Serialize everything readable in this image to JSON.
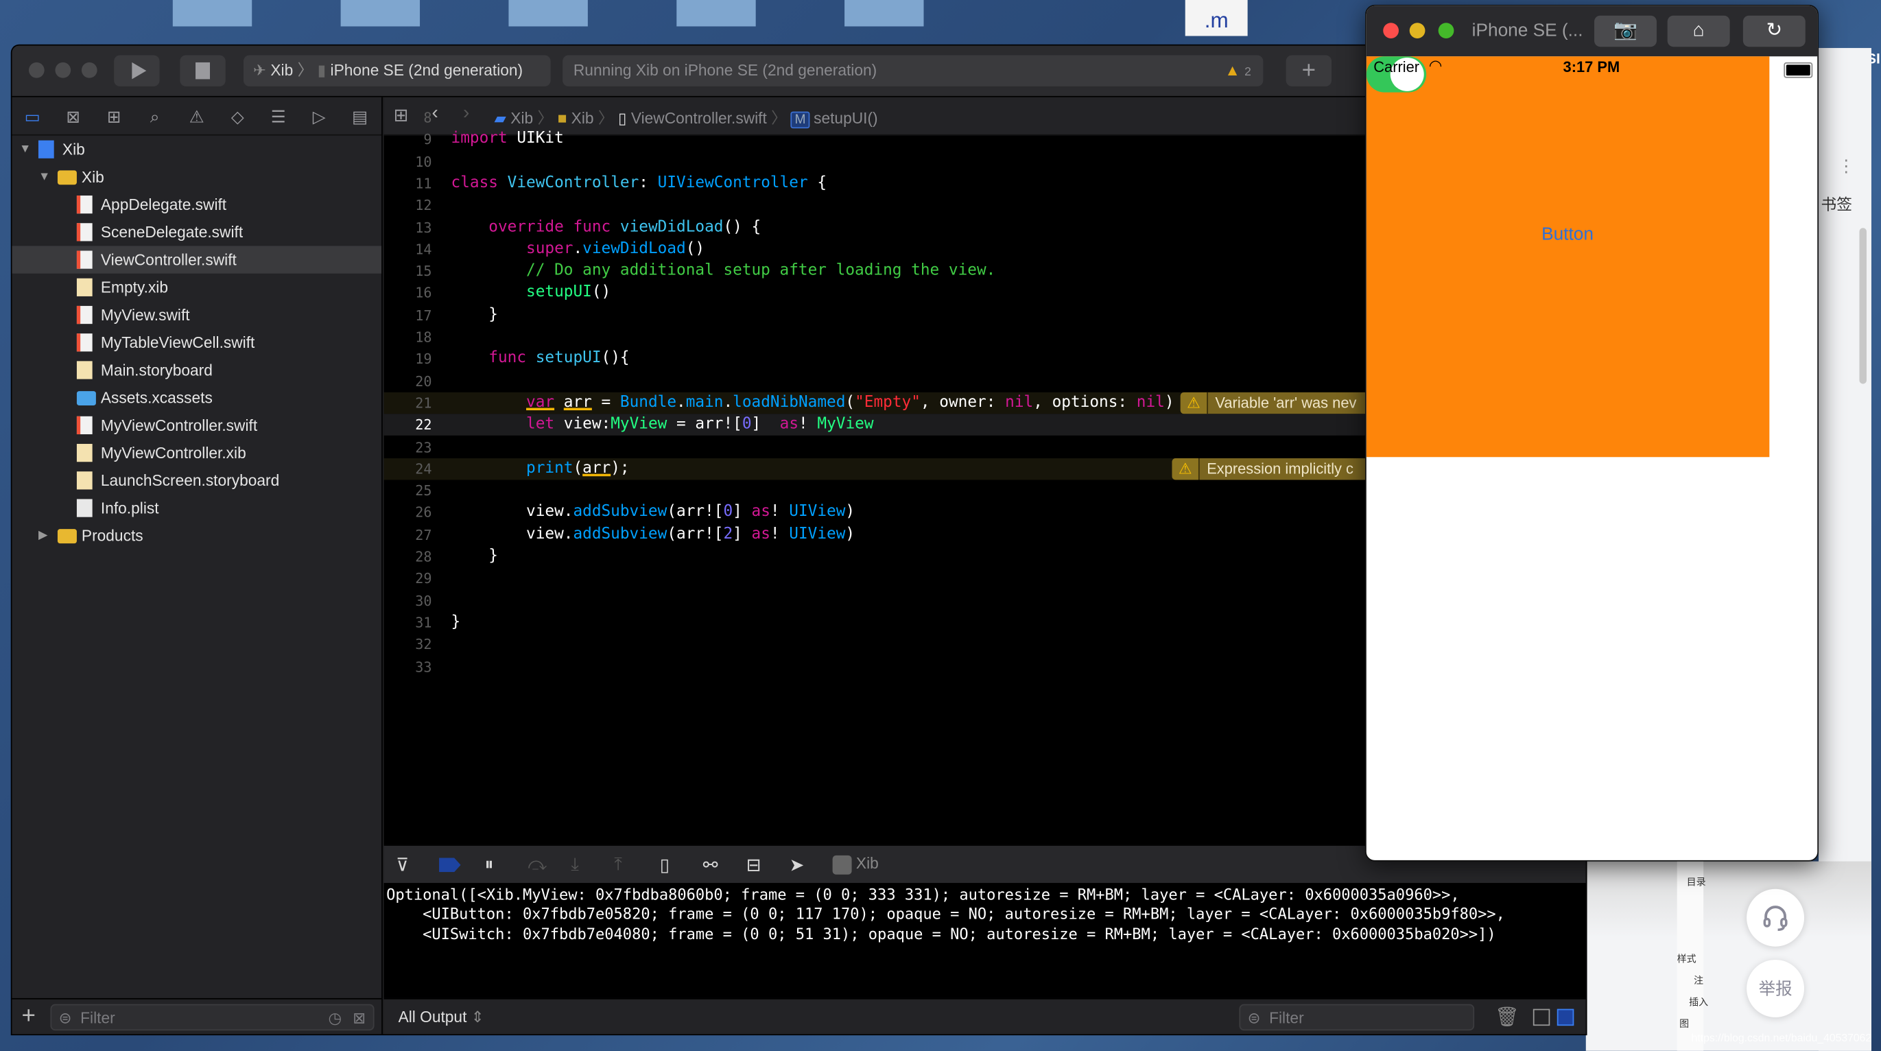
{
  "desktop": {
    "thumbnail_label": ".m",
    "right_edge_text": "SI"
  },
  "xcode": {
    "toolbar": {
      "scheme": "Xib",
      "device": "iPhone SE (2nd generation)",
      "status": "Running Xib on iPhone SE (2nd generation)",
      "warning_count": "2",
      "add_label": "+"
    },
    "jumpbar": [
      "Xib",
      "Xib",
      "ViewController.swift",
      "setupUI()"
    ],
    "jumpbar_method_badge": "M",
    "navigator": {
      "items": [
        {
          "label": "Xib",
          "icon": "xcode-project-icon",
          "level": 0,
          "disclosure": "open"
        },
        {
          "label": "Xib",
          "icon": "folder-icon",
          "level": 1,
          "disclosure": "open"
        },
        {
          "label": "AppDelegate.swift",
          "icon": "swift-file-icon",
          "level": 2
        },
        {
          "label": "SceneDelegate.swift",
          "icon": "swift-file-icon",
          "level": 2
        },
        {
          "label": "ViewController.swift",
          "icon": "swift-file-icon",
          "level": 2,
          "selected": true
        },
        {
          "label": "Empty.xib",
          "icon": "xib-file-icon",
          "level": 2
        },
        {
          "label": "MyView.swift",
          "icon": "swift-file-icon",
          "level": 2
        },
        {
          "label": "MyTableViewCell.swift",
          "icon": "swift-file-icon",
          "level": 2
        },
        {
          "label": "Main.storyboard",
          "icon": "storyboard-file-icon",
          "level": 2
        },
        {
          "label": "Assets.xcassets",
          "icon": "asset-folder-icon",
          "level": 2
        },
        {
          "label": "MyViewController.swift",
          "icon": "swift-file-icon",
          "level": 2
        },
        {
          "label": "MyViewController.xib",
          "icon": "xib-file-icon",
          "level": 2
        },
        {
          "label": "LaunchScreen.storyboard",
          "icon": "storyboard-file-icon",
          "level": 2
        },
        {
          "label": "Info.plist",
          "icon": "plist-file-icon",
          "level": 2
        },
        {
          "label": "Products",
          "icon": "folder-icon",
          "level": 1,
          "disclosure": "closed"
        }
      ],
      "filter_placeholder": "Filter"
    },
    "editor": {
      "current_line": 22,
      "lines": [
        {
          "n": "8",
          "t": []
        },
        {
          "n": "9",
          "t": [
            [
              "k",
              "import"
            ],
            [
              "p",
              " UIKit"
            ]
          ]
        },
        {
          "n": "10",
          "t": []
        },
        {
          "n": "11",
          "t": [
            [
              "k",
              "class"
            ],
            [
              "p",
              " "
            ],
            [
              "d",
              "ViewController"
            ],
            [
              "p",
              ": "
            ],
            [
              "o",
              "UIViewController"
            ],
            [
              "p",
              " {"
            ]
          ]
        },
        {
          "n": "12",
          "t": []
        },
        {
          "n": "13",
          "t": [
            [
              "p",
              "    "
            ],
            [
              "k",
              "override"
            ],
            [
              "p",
              " "
            ],
            [
              "k",
              "func"
            ],
            [
              "p",
              " "
            ],
            [
              "d",
              "viewDidLoad"
            ],
            [
              "p",
              "() {"
            ]
          ]
        },
        {
          "n": "14",
          "t": [
            [
              "p",
              "        "
            ],
            [
              "k",
              "super"
            ],
            [
              "p",
              "."
            ],
            [
              "o",
              "viewDidLoad"
            ],
            [
              "p",
              "()"
            ]
          ]
        },
        {
          "n": "15",
          "t": [
            [
              "p",
              "        "
            ],
            [
              "c",
              "// Do any additional setup after loading the view."
            ]
          ]
        },
        {
          "n": "16",
          "t": [
            [
              "p",
              "        "
            ],
            [
              "g",
              "setupUI"
            ],
            [
              "p",
              "()"
            ]
          ]
        },
        {
          "n": "17",
          "t": [
            [
              "p",
              "    }"
            ]
          ]
        },
        {
          "n": "18",
          "t": []
        },
        {
          "n": "19",
          "t": [
            [
              "p",
              "    "
            ],
            [
              "k",
              "func"
            ],
            [
              "p",
              " "
            ],
            [
              "d",
              "setupUI"
            ],
            [
              "p",
              "(){"
            ]
          ]
        },
        {
          "n": "20",
          "t": []
        },
        {
          "n": "21",
          "t": [
            [
              "p",
              "        "
            ],
            [
              "ku",
              "var"
            ],
            [
              "p",
              " "
            ],
            [
              "pu",
              "arr"
            ],
            [
              "p",
              " = "
            ],
            [
              "o",
              "Bundle"
            ],
            [
              "p",
              "."
            ],
            [
              "o",
              "main"
            ],
            [
              "p",
              "."
            ],
            [
              "o",
              "loadNibNamed"
            ],
            [
              "p",
              "("
            ],
            [
              "s",
              "\"Empty\""
            ],
            [
              "p",
              ", owner: "
            ],
            [
              "k",
              "nil"
            ],
            [
              "p",
              ", options: "
            ],
            [
              "k",
              "nil"
            ],
            [
              "p",
              ")"
            ]
          ],
          "warning": "Variable 'arr' was nev"
        },
        {
          "n": "22",
          "t": [
            [
              "p",
              "        "
            ],
            [
              "k",
              "let"
            ],
            [
              "p",
              " view:"
            ],
            [
              "g",
              "MyView"
            ],
            [
              "p",
              " = arr!["
            ],
            [
              "n",
              "0"
            ],
            [
              "p",
              "]  "
            ],
            [
              "k",
              "as"
            ],
            [
              "p",
              "! "
            ],
            [
              "g",
              "MyView"
            ]
          ]
        },
        {
          "n": "23",
          "t": []
        },
        {
          "n": "24",
          "t": [
            [
              "p",
              "        "
            ],
            [
              "o",
              "print"
            ],
            [
              "p",
              "("
            ],
            [
              "pu",
              "arr"
            ],
            [
              "p",
              ");"
            ]
          ],
          "warning": "Expression implicitly c"
        },
        {
          "n": "25",
          "t": []
        },
        {
          "n": "26",
          "t": [
            [
              "p",
              "        view."
            ],
            [
              "o",
              "addSubview"
            ],
            [
              "p",
              "(arr!["
            ],
            [
              "n",
              "0"
            ],
            [
              "p",
              "] "
            ],
            [
              "k",
              "as"
            ],
            [
              "p",
              "! "
            ],
            [
              "o",
              "UIView"
            ],
            [
              "p",
              ")"
            ]
          ]
        },
        {
          "n": "27",
          "t": [
            [
              "p",
              "        view."
            ],
            [
              "o",
              "addSubview"
            ],
            [
              "p",
              "(arr!["
            ],
            [
              "n",
              "2"
            ],
            [
              "p",
              "] "
            ],
            [
              "k",
              "as"
            ],
            [
              "p",
              "! "
            ],
            [
              "o",
              "UIView"
            ],
            [
              "p",
              ")"
            ]
          ]
        },
        {
          "n": "28",
          "t": [
            [
              "p",
              "    }"
            ]
          ]
        },
        {
          "n": "29",
          "t": []
        },
        {
          "n": "30",
          "t": []
        },
        {
          "n": "31",
          "t": [
            [
              "p",
              "}"
            ]
          ]
        },
        {
          "n": "32",
          "t": []
        },
        {
          "n": "33",
          "t": []
        }
      ]
    },
    "debugbar": {
      "target": "Xib"
    },
    "console": {
      "lines": [
        "Optional([<Xib.MyView: 0x7fbdba8060b0; frame = (0 0; 333 331); autoresize = RM+BM; layer = <CALayer: 0x6000035a0960>>,",
        "    <UIButton: 0x7fbdb7e05820; frame = (0 0; 117 170); opaque = NO; autoresize = RM+BM; layer = <CALayer: 0x6000035b9f80>>,",
        "    <UISwitch: 0x7fbdb7e04080; frame = (0 0; 51 31); opaque = NO; autoresize = RM+BM; layer = <CALayer: 0x6000035ba020>>])"
      ],
      "output_selector": "All Output",
      "filter_placeholder": "Filter"
    }
  },
  "simulator": {
    "title": "iPhone SE (...",
    "status_bar": {
      "carrier": "Carrier",
      "time": "3:17 PM"
    },
    "button_label": "Button",
    "switch_on": true,
    "colors": {
      "view_background": "#fe850a",
      "button_text": "#2f6fd6",
      "switch_on": "#34c759"
    }
  },
  "web_page": {
    "bookmark_text": "书签",
    "toc_label": "目录",
    "side_tags": [
      "样式",
      "注",
      "插入",
      "图"
    ],
    "report_button": "举报",
    "support_icon": "headset-icon",
    "watermark": "https://blog.csdn.net/baidu_40537062"
  }
}
